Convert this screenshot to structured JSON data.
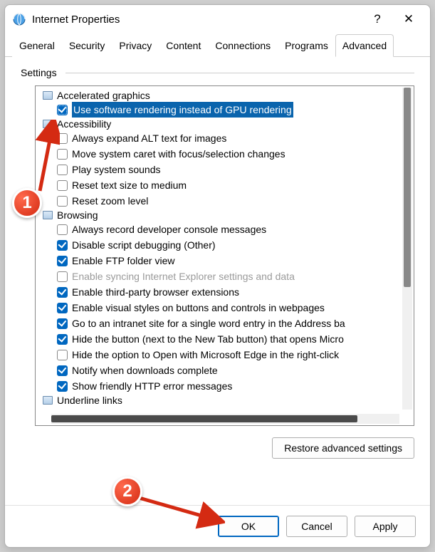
{
  "window": {
    "title": "Internet Properties",
    "help_label": "?",
    "close_label": "✕"
  },
  "tabs": [
    "General",
    "Security",
    "Privacy",
    "Content",
    "Connections",
    "Programs",
    "Advanced"
  ],
  "active_tab": "Advanced",
  "settings_label": "Settings",
  "tree": [
    {
      "type": "section",
      "label": "Accelerated graphics"
    },
    {
      "type": "item",
      "checked": true,
      "selected": true,
      "label": "Use software rendering instead of GPU rendering"
    },
    {
      "type": "section",
      "label": "Accessibility"
    },
    {
      "type": "item",
      "checked": false,
      "label": "Always expand ALT text for images"
    },
    {
      "type": "item",
      "checked": false,
      "label": "Move system caret with focus/selection changes"
    },
    {
      "type": "item",
      "checked": false,
      "label": "Play system sounds"
    },
    {
      "type": "item",
      "checked": false,
      "label": "Reset text size to medium"
    },
    {
      "type": "item",
      "checked": false,
      "label": "Reset zoom level"
    },
    {
      "type": "section",
      "label": "Browsing"
    },
    {
      "type": "item",
      "checked": false,
      "label": "Always record developer console messages"
    },
    {
      "type": "item",
      "checked": true,
      "label": "Disable script debugging (Other)"
    },
    {
      "type": "item",
      "checked": true,
      "label": "Enable FTP folder view"
    },
    {
      "type": "item",
      "checked": false,
      "disabled": true,
      "label": "Enable syncing Internet Explorer settings and data"
    },
    {
      "type": "item",
      "checked": true,
      "label": "Enable third-party browser extensions"
    },
    {
      "type": "item",
      "checked": true,
      "label": "Enable visual styles on buttons and controls in webpages"
    },
    {
      "type": "item",
      "checked": true,
      "label": "Go to an intranet site for a single word entry in the Address ba"
    },
    {
      "type": "item",
      "checked": true,
      "label": "Hide the button (next to the New Tab button) that opens Micro"
    },
    {
      "type": "item",
      "checked": false,
      "label": "Hide the option to Open with Microsoft Edge in the right-click"
    },
    {
      "type": "item",
      "checked": true,
      "label": "Notify when downloads complete"
    },
    {
      "type": "item",
      "checked": true,
      "label": "Show friendly HTTP error messages"
    },
    {
      "type": "section",
      "label": "Underline links"
    }
  ],
  "buttons": {
    "restore": "Restore advanced settings",
    "ok": "OK",
    "cancel": "Cancel",
    "apply": "Apply"
  },
  "annotations": {
    "one": "1",
    "two": "2"
  }
}
